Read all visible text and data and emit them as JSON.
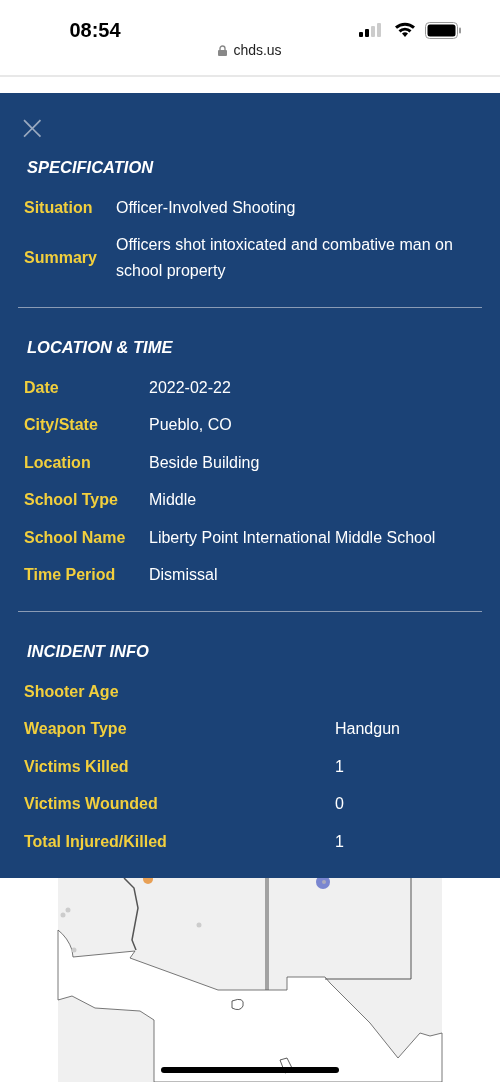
{
  "status_bar": {
    "time": "08:54"
  },
  "address_bar": {
    "url": "chds.us"
  },
  "panel": {
    "close": "×",
    "sections": [
      {
        "title": "SPECIFICATION",
        "fields": [
          {
            "label": "Situation",
            "value": "Officer-Involved Shooting"
          },
          {
            "label": "Summary",
            "value": "Officers shot intoxicated and combative man on school property"
          }
        ]
      },
      {
        "title": "LOCATION & TIME",
        "fields": [
          {
            "label": "Date",
            "value": "2022-02-22"
          },
          {
            "label": "City/State",
            "value": "Pueblo, CO"
          },
          {
            "label": "Location",
            "value": "Beside Building"
          },
          {
            "label": "School Type",
            "value": "Middle"
          },
          {
            "label": "School Name",
            "value": "Liberty Point International Middle School"
          },
          {
            "label": "Time Period",
            "value": "Dismissal"
          }
        ]
      },
      {
        "title": "INCIDENT INFO",
        "fields": [
          {
            "label": "Shooter Age"
          },
          {
            "label": "Weapon Type",
            "value": "Handgun"
          },
          {
            "label": "Victims Killed",
            "value": "1"
          },
          {
            "label": "Victims Wounded",
            "value": "0"
          },
          {
            "label": "Total Injured/Killed",
            "value": "1"
          }
        ]
      }
    ]
  }
}
